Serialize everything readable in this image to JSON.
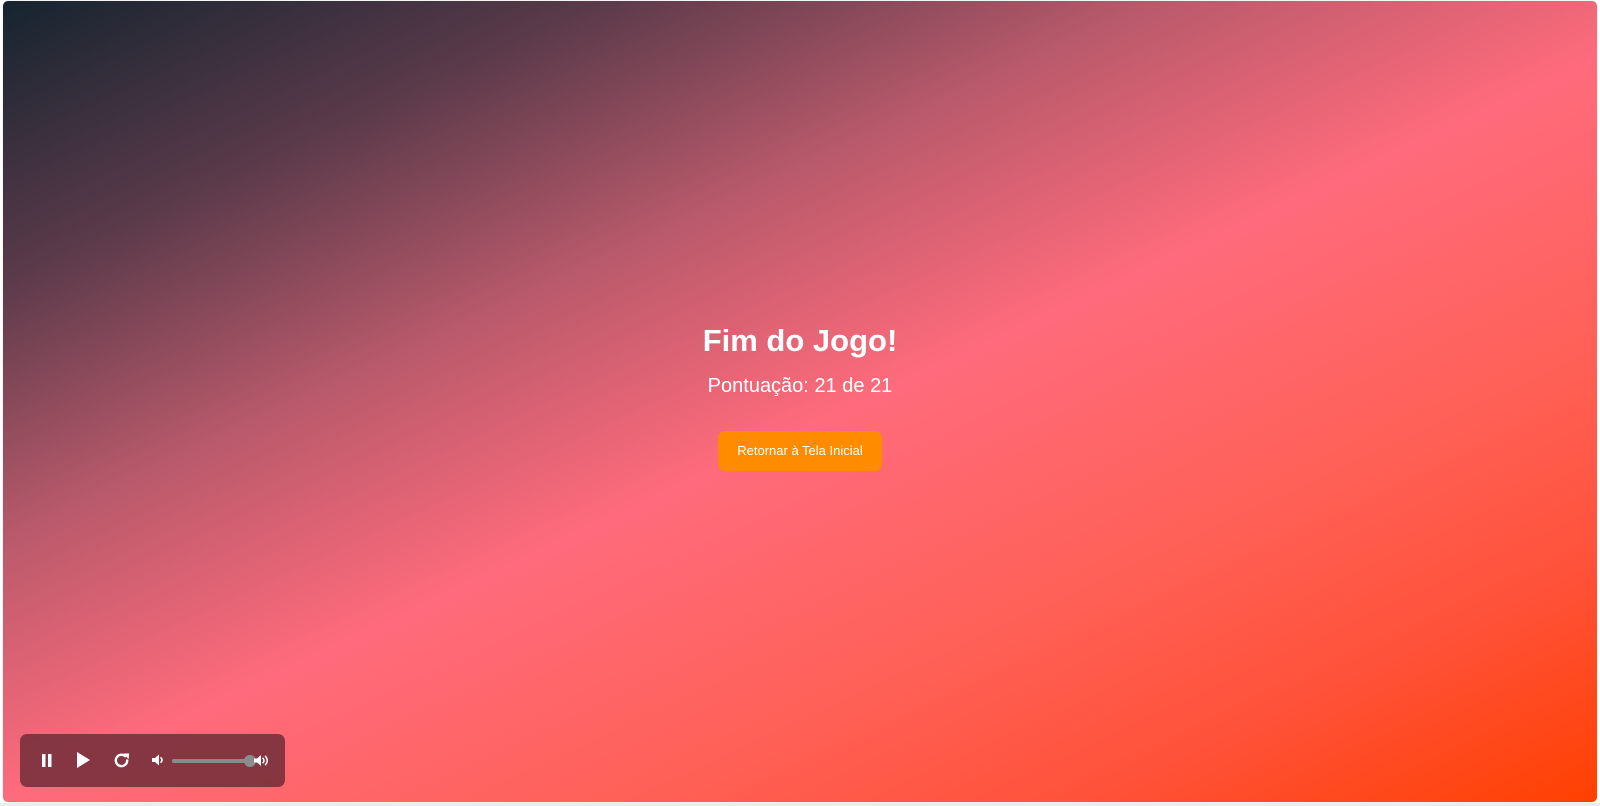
{
  "game_over": {
    "title": "Fim do Jogo!",
    "score_label": "Pontuação:",
    "score_value": "21",
    "score_separator": "de",
    "score_total": "21"
  },
  "actions": {
    "return_label": "Retornar à Tela Inicial"
  },
  "audio_controls": {
    "pause_icon": "pause-icon",
    "play_icon": "play-icon",
    "restart_icon": "restart-icon",
    "volume_low_icon": "volume-low-icon",
    "volume_high_icon": "volume-high-icon",
    "volume_level": 1.0
  },
  "colors": {
    "button_bg": "#ff8c00",
    "gradient_dark": "#15242f",
    "gradient_pink": "#ff6b7c",
    "gradient_orange": "#ff4000"
  }
}
